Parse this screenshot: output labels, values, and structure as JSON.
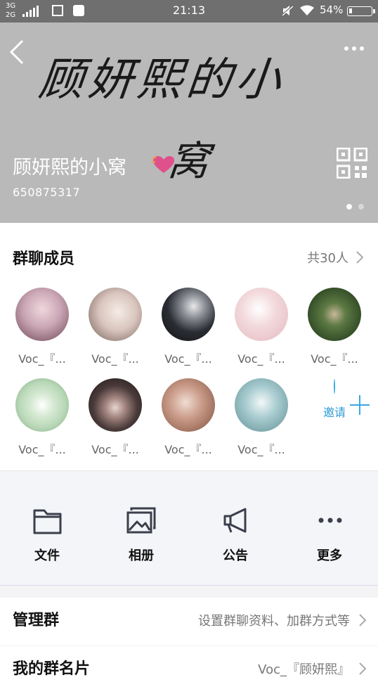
{
  "status_bar": {
    "network_top": "3G",
    "network_bottom": "2G",
    "time": "21:13",
    "battery": "54%"
  },
  "header": {
    "cover_text": "顾妍熙的小",
    "cover_text_tail": "窝",
    "group_name": "顾妍熙的小窝",
    "group_id": "650875317",
    "icons": [
      "back-icon",
      "more-icon",
      "qr-code-icon",
      "heart-icon"
    ]
  },
  "members": {
    "title": "群聊成员",
    "count_label": "共30人",
    "items": [
      {
        "name": "Voc_『...",
        "color": "#c9a5b4"
      },
      {
        "name": "Voc_『...",
        "color": "#d9c5bd"
      },
      {
        "name": "Voc_『...",
        "color": "#2a2d33"
      },
      {
        "name": "Voc_『...",
        "color": "#f2d9dc"
      },
      {
        "name": "Voc_『...",
        "color": "#3e5a2f"
      },
      {
        "name": "Voc_『...",
        "color": "#b9d8b8"
      },
      {
        "name": "Voc_『...",
        "color": "#4a3b3a"
      },
      {
        "name": "Voc_『...",
        "color": "#c99a88"
      },
      {
        "name": "Voc_『...",
        "color": "#a8ccd0"
      }
    ],
    "invite_label": "邀请",
    "accent": "#3aa6e0"
  },
  "actions": {
    "files": "文件",
    "album": "相册",
    "notice": "公告",
    "more": "更多"
  },
  "manage": {
    "title": "管理群",
    "value": "设置群聊资料、加群方式等"
  },
  "card": {
    "title": "我的群名片",
    "value": "Voc_『顾妍熙』"
  }
}
